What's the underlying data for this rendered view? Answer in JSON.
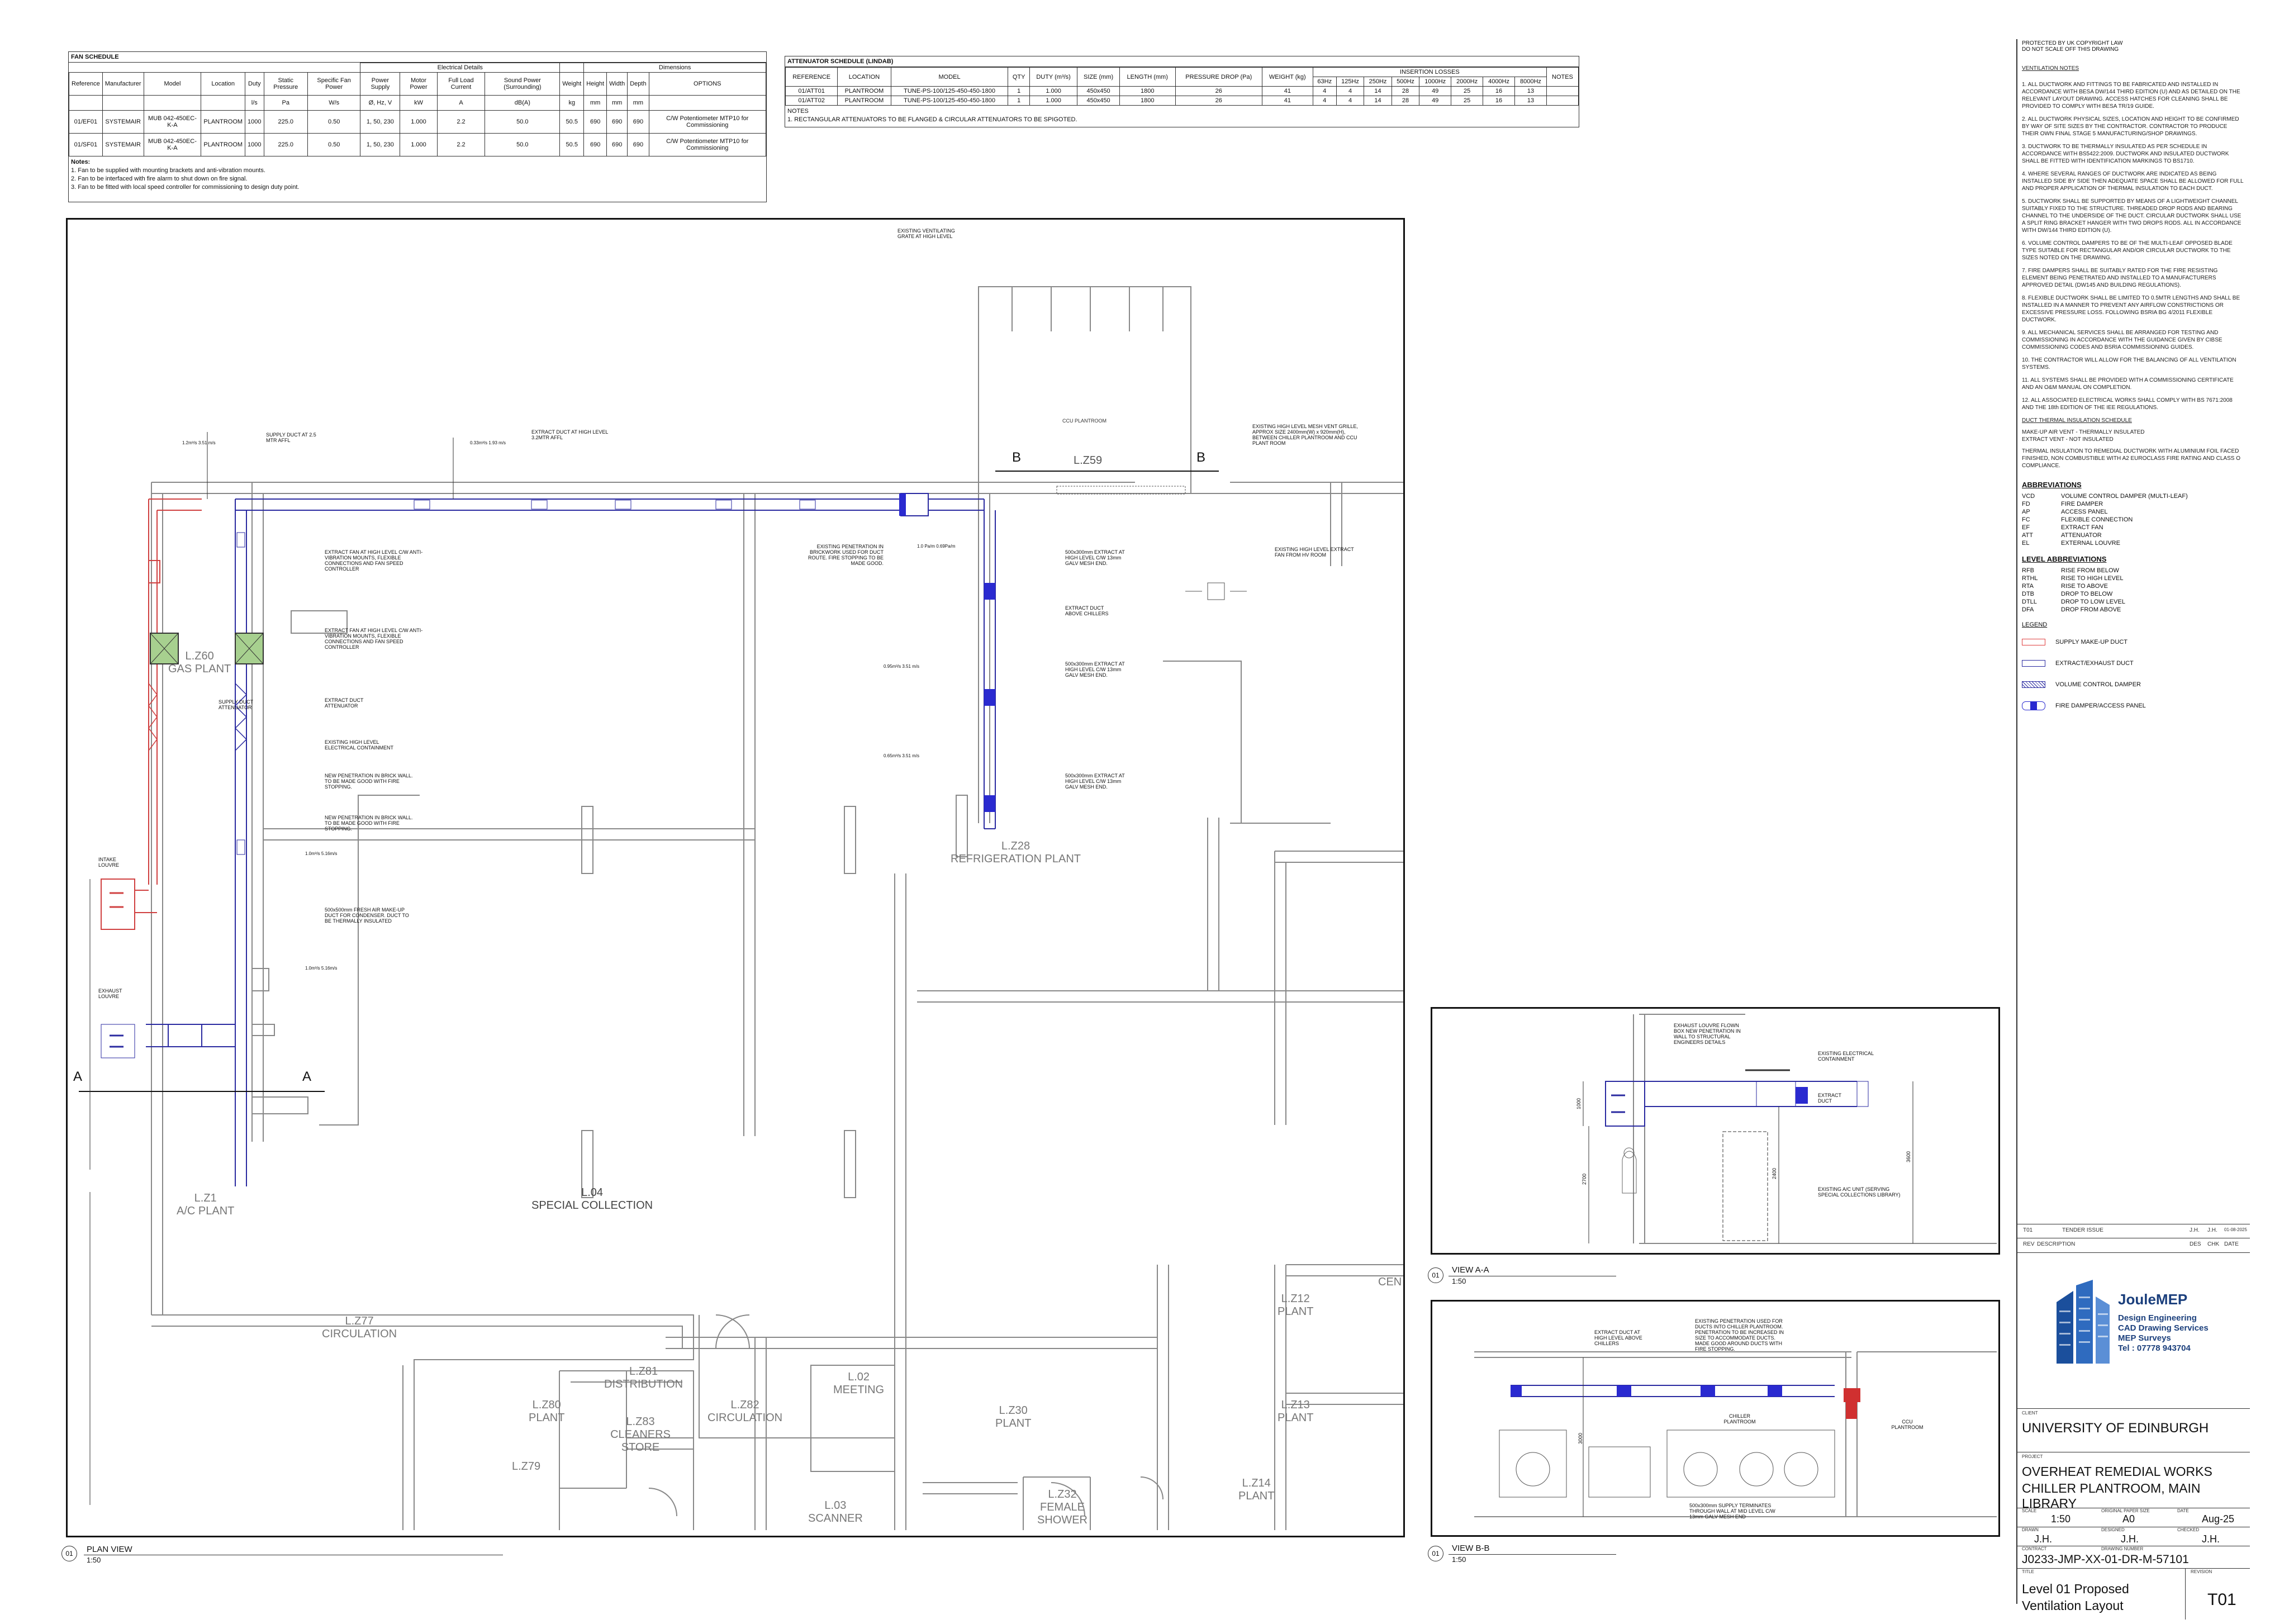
{
  "fan_schedule": {
    "title": "FAN SCHEDULE",
    "group_headers": [
      "Electrical Details",
      "Dimensions"
    ],
    "headers": [
      "Reference",
      "Manufacturer",
      "Model",
      "Location",
      "Duty",
      "Static Pressure",
      "Specific Fan Power",
      "Power Supply",
      "Motor Power",
      "Full Load Current",
      "Sound Power (Surrounding)",
      "Weight",
      "Height",
      "Width",
      "Depth",
      "OPTIONS"
    ],
    "units": [
      "",
      "",
      "",
      "",
      "l/s",
      "Pa",
      "W/s",
      "Ø, Hz, V",
      "kW",
      "A",
      "dB(A)",
      "kg",
      "mm",
      "mm",
      "mm",
      ""
    ],
    "rows": [
      [
        "01/EF01",
        "SYSTEMAIR",
        "MUB 042-450EC-K-A",
        "PLANTROOM",
        "1000",
        "225.0",
        "0.50",
        "1, 50, 230",
        "1.000",
        "2.2",
        "50.0",
        "50.5",
        "690",
        "690",
        "690",
        "C/W Potentiometer MTP10 for Commissioning"
      ],
      [
        "01/SF01",
        "SYSTEMAIR",
        "MUB 042-450EC-K-A",
        "PLANTROOM",
        "1000",
        "225.0",
        "0.50",
        "1, 50, 230",
        "1.000",
        "2.2",
        "50.0",
        "50.5",
        "690",
        "690",
        "690",
        "C/W Potentiometer MTP10 for Commissioning"
      ]
    ],
    "notes_title": "Notes:",
    "notes": [
      "1. Fan to be supplied with mounting brackets and anti-vibration mounts.",
      "2. Fan to be interfaced with fire alarm to shut down on fire signal.",
      "3. Fan to be fitted with local speed controller for commissioning to design duty point."
    ]
  },
  "attenuator_schedule": {
    "title": "ATTENUATOR SCHEDULE (LINDAB)",
    "headers": [
      "REFERENCE",
      "LOCATION",
      "MODEL",
      "QTY",
      "DUTY (m³/s)",
      "SIZE (mm)",
      "LENGTH (mm)",
      "PRESSURE DROP (Pa)",
      "WEIGHT (kg)",
      "INSERTION LOSSES",
      "NOTES"
    ],
    "bands": [
      "63Hz",
      "125Hz",
      "250Hz",
      "500Hz",
      "1000Hz",
      "2000Hz",
      "4000Hz",
      "8000Hz"
    ],
    "rows": [
      [
        "01/ATT01",
        "PLANTROOM",
        "TUNE-PS-100/125-450-450-1800",
        "1",
        "1.000",
        "450x450",
        "1800",
        "26",
        "41",
        "4",
        "4",
        "14",
        "28",
        "49",
        "25",
        "16",
        "13",
        ""
      ],
      [
        "01/ATT02",
        "PLANTROOM",
        "TUNE-PS-100/125-450-450-1800",
        "1",
        "1.000",
        "450x450",
        "1800",
        "26",
        "41",
        "4",
        "4",
        "14",
        "28",
        "49",
        "25",
        "16",
        "13",
        ""
      ]
    ],
    "notes_title": "NOTES",
    "notes": [
      "1. RECTANGULAR ATTENUATORS TO BE FLANGED & CIRCULAR ATTENUATORS TO BE SPIGOTED."
    ]
  },
  "plan": {
    "rooms": [
      {
        "name": "L.Z59"
      },
      {
        "name": "L.Z60",
        "sub": "GAS PLANT"
      },
      {
        "name": "L.Z28",
        "sub": "REFRIGERATION PLANT"
      },
      {
        "name": "L.04",
        "sub": "SPECIAL COLLECTION"
      },
      {
        "name": "L.Z1",
        "sub": "A/C PLANT"
      },
      {
        "name": "L.Z77",
        "sub": "CIRCULATION"
      },
      {
        "name": "L.Z81",
        "sub": "DISTRIBUTION"
      },
      {
        "name": "L.Z80",
        "sub": "PLANT"
      },
      {
        "name": "L.Z83",
        "sub": "CLEANERS STORE"
      },
      {
        "name": "L.Z82",
        "sub": "CIRCULATION"
      },
      {
        "name": "L.02",
        "sub": "MEETING"
      },
      {
        "name": "L.Z30",
        "sub": "PLANT"
      },
      {
        "name": "L.Z12",
        "sub": "PLANT"
      },
      {
        "name": "L.Z13",
        "sub": "PLANT"
      },
      {
        "name": "L.Z14",
        "sub": "PLANT"
      },
      {
        "name": "L.Z32",
        "sub": "FEMALE SHOWER"
      },
      {
        "name": "L.03",
        "sub": "SCANNER"
      },
      {
        "name": "L.Z79"
      },
      {
        "name": "CEN"
      }
    ],
    "ccu_label": "CCU PLANTROOM",
    "annotations": {
      "grate": "EXISTING VENTILATING GRATE AT HIGH LEVEL",
      "supply_duct": "SUPPLY DUCT AT 2.5 MTR AFFL",
      "extract_duct": "EXTRACT DUCT AT HIGH LEVEL 3.2MTR AFFL",
      "mesh_grille": "EXISTING HIGH LEVEL MESH VENT GRILLE, APPROX SIZE 2400mm(W) x 920mm(H), BETWEEN CHILLER PLANTROOM AND CCU PLANT ROOM",
      "penetration": "EXISTING PENETRATION IN BRICKWORK USED FOR DUCT ROUTE. FIRE STOPPING TO BE MADE GOOD.",
      "extract_fan_1": "EXTRACT FAN AT HIGH LEVEL C/W ANTI-VIBRATION MOUNTS, FLEXIBLE CONNECTIONS AND FAN SPEED CONTROLLER",
      "extract_fan_2": "EXTRACT FAN AT HIGH LEVEL C/W ANTI-VIBRATION MOUNTS, FLEXIBLE CONNECTIONS AND FAN SPEED CONTROLLER",
      "extract_att": "EXTRACT DUCT ATTENUATOR",
      "supply_att": "SUPPLY DUCT ATTENUATOR",
      "containment": "EXISTING HIGH LEVEL ELECTRICAL CONTAINMENT",
      "new_pen_1": "NEW PENETRATION IN BRICK WALL. TO BE MADE GOOD WITH FIRE STOPPING.",
      "new_pen_2": "NEW PENETRATION IN BRICK WALL. TO BE MADE GOOD WITH FIRE STOPPING.",
      "fresh_air": "500x500mm FRESH AIR MAKE-UP DUCT FOR CONDENSER. DUCT TO BE THERMALLY INSULATED",
      "intake": "INTAKE LOUVRE",
      "exhaust": "EXHAUST LOUVRE",
      "extract_hv": "EXISTING HIGH LEVEL EXTRACT FAN FROM HV ROOM",
      "extract_chillers": "EXTRACT DUCT ABOVE CHILLERS",
      "ext1": "500x300mm EXTRACT AT HIGH LEVEL C/W 13mm GALV MESH END.",
      "ext2": "500x300mm EXTRACT AT HIGH LEVEL C/W 13mm GALV MESH END.",
      "ext3": "500x300mm EXTRACT AT HIGH LEVEL C/W 13mm GALV MESH END."
    },
    "duct_sizes": [
      "200x150",
      "300x200",
      "450x450",
      "300x300",
      "400x400",
      "300x300",
      "500x300",
      "550x300",
      "450x450"
    ],
    "flow_labels": [
      "1.2m³/s 3.51 m/s",
      "1.0 Pa/m 0.69Pa/m",
      "0.95m³/s 3.51 m/s",
      "0.65m³/s 3.51 m/s",
      "0.33m³/s 1.93 m/s",
      "1.0m³/s 5.16m/s",
      "1.0m³/s 5.16m/s"
    ],
    "section_marks": {
      "a": "A",
      "b": "B"
    },
    "dims": [
      "1500",
      "2500",
      "1000",
      "11400",
      "400"
    ],
    "title": "PLAN VIEW",
    "scale": "1:50",
    "num": "01"
  },
  "view_aa": {
    "title": "VIEW A-A",
    "scale": "1:50",
    "num": "01",
    "annotations": {
      "louvre": "EXHAUST LOUVRE FLOWN BOX NEW PENETRATION IN WALL TO STRUCTURAL ENGINEERS DETAILS",
      "containment": "EXISTING ELECTRICAL CONTAINMENT",
      "extract_duct": "EXTRACT DUCT",
      "ac_unit": "EXISTING A/C UNIT (SERVING SPECIAL COLLECTIONS LIBRARY)"
    },
    "dims": [
      "1000",
      "3600",
      "2700",
      "2400"
    ]
  },
  "view_bb": {
    "title": "VIEW B-B",
    "scale": "1:50",
    "num": "01",
    "annotations": {
      "extract_duct": "EXTRACT DUCT AT HIGH LEVEL ABOVE CHILLERS",
      "penetration": "EXISTING PENETRATION USED FOR DUCTS INTO CHILLER PLANTROOM. PENETRATION TO BE INCREASED IN SIZE TO ACCOMMODATE DUCTS. MADE GOOD AROUND DUCTS WITH FIRE STOPPING.",
      "chiller": "CHILLER PLANTROOM",
      "ccu": "CCU PLANTROOM",
      "supply_term": "500x300mm SUPPLY TERMINATES THROUGH WALL AT MID LEVEL C/W 13mm GALV MESH END"
    },
    "dims": [
      "3000"
    ]
  },
  "title_block": {
    "copyright": "PROTECTED BY UK COPYRIGHT LAW",
    "no_scale": "DO NOT SCALE OFF THIS DRAWING",
    "notes_title": "VENTILATION NOTES",
    "notes": [
      "1. ALL DUCTWORK AND FITTINGS TO BE FABRICATED AND INSTALLED IN ACCORDANCE WITH BESA DW/144 THIRD EDITION (U) AND AS DETAILED ON THE RELEVANT LAYOUT DRAWING. ACCESS HATCHES FOR CLEANING SHALL BE PROVIDED TO COMPLY WITH BESA TR/19 GUIDE.",
      "2. ALL DUCTWORK PHYSICAL SIZES, LOCATION AND HEIGHT TO BE CONFIRMED BY WAY OF SITE SIZES BY THE CONTRACTOR. CONTRACTOR TO PRODUCE THEIR OWN FINAL STAGE 5 MANUFACTURING/SHOP DRAWINGS.",
      "3. DUCTWORK TO BE THERMALLY INSULATED AS PER SCHEDULE IN ACCORDANCE WITH BS5422:2009. DUCTWORK AND INSULATED DUCTWORK SHALL BE FITTED WITH IDENTIFICATION MARKINGS TO BS1710.",
      "4. WHERE SEVERAL RANGES OF DUCTWORK ARE INDICATED AS BEING INSTALLED SIDE BY SIDE THEN ADEQUATE SPACE SHALL BE ALLOWED FOR FULL AND PROPER APPLICATION OF THERMAL INSULATION TO EACH DUCT.",
      "5. DUCTWORK SHALL BE SUPPORTED BY MEANS OF A LIGHTWEIGHT CHANNEL SUITABLY FIXED TO THE STRUCTURE. THREADED DROP RODS AND BEARING CHANNEL TO THE UNDERSIDE OF THE DUCT. CIRCULAR DUCTWORK SHALL USE A SPLIT RING BRACKET HANGER WITH TWO DROPS RODS. ALL IN ACCORDANCE WITH DW/144 THIRD EDITION (U).",
      "6. VOLUME CONTROL DAMPERS TO BE OF THE MULTI-LEAF OPPOSED BLADE TYPE SUITABLE FOR RECTANGULAR AND/OR CIRCULAR DUCTWORK TO THE SIZES NOTED ON THE DRAWING.",
      "7. FIRE DAMPERS SHALL BE SUITABLY RATED FOR THE FIRE RESISTING ELEMENT BEING PENETRATED AND INSTALLED TO A MANUFACTURERS APPROVED DETAIL (DW145 AND BUILDING REGULATIONS).",
      "8. FLEXIBLE DUCTWORK SHALL BE LIMITED TO 0.5MTR LENGTHS AND SHALL BE INSTALLED IN A MANNER TO PREVENT ANY AIRFLOW CONSTRICTIONS OR EXCESSIVE PRESSURE LOSS. FOLLOWING BSRIA BG 4/2011 FLEXIBLE DUCTWORK.",
      "9. ALL MECHANICAL SERVICES SHALL BE ARRANGED FOR TESTING AND COMMISSIONING IN ACCORDANCE WITH THE GUIDANCE GIVEN BY CIBSE COMMISSIONING CODES AND BSRIA COMMISSIONING GUIDES.",
      "10. THE CONTRACTOR WILL ALLOW FOR THE BALANCING OF ALL VENTILATION SYSTEMS.",
      "11. ALL SYSTEMS SHALL BE PROVIDED WITH A COMMISSIONING CERTIFICATE AND AN O&M MANUAL ON COMPLETION.",
      "12. ALL ASSOCIATED ELECTRICAL WORKS SHALL COMPLY WITH BS 7671:2008 AND THE 18th EDITION OF THE IEE REGULATIONS."
    ],
    "insulation_title": "DUCT THERMAL INSULATION SCHEDULE",
    "insulation": [
      "MAKE-UP AIR VENT - THERMALLY INSULATED",
      "EXTRACT VENT - NOT INSULATED",
      "THERMAL INSULATION TO REMEDIAL DUCTWORK WITH ALUMINIUM FOIL FACED FINISHED, NON COMBUSTIBLE WITH A2 EUROCLASS FIRE RATING AND CLASS O COMPLIANCE."
    ],
    "abbr_title": "ABBREVIATIONS",
    "abbreviations": [
      [
        "VCD",
        "VOLUME CONTROL DAMPER (MULTI-LEAF)"
      ],
      [
        "FD",
        "FIRE DAMPER"
      ],
      [
        "AP",
        "ACCESS PANEL"
      ],
      [
        "FC",
        "FLEXIBLE CONNECTION"
      ],
      [
        "EF",
        "EXTRACT FAN"
      ],
      [
        "ATT",
        "ATTENUATOR"
      ],
      [
        "EL",
        "EXTERNAL LOUVRE"
      ]
    ],
    "level_title": "LEVEL ABBREVIATIONS",
    "levels": [
      [
        "RFB",
        "RISE FROM BELOW"
      ],
      [
        "RTHL",
        "RISE TO HIGH LEVEL"
      ],
      [
        "RTA",
        "RISE TO ABOVE"
      ],
      [
        "DTB",
        "DROP TO BELOW"
      ],
      [
        "DTLL",
        "DROP TO LOW LEVEL"
      ],
      [
        "DFA",
        "DROP FROM ABOVE"
      ]
    ],
    "legend_title": "LEGEND",
    "legend": [
      {
        "label": "SUPPLY MAKE-UP DUCT",
        "color": "#e04040"
      },
      {
        "label": "EXTRACT/EXHAUST DUCT",
        "color": "#2a2aa0"
      },
      {
        "label": "VOLUME CONTROL DAMPER",
        "color": "#2a2aa0"
      },
      {
        "label": "FIRE DAMPER/ACCESS PANEL",
        "color": "#2a2ad0"
      }
    ],
    "revision_row": [
      "T01",
      "TENDER ISSUE",
      "J.H.",
      "J.H.",
      "01-08-2025"
    ],
    "revision_headers": [
      "REV",
      "DESCRIPTION",
      "DES",
      "CHK",
      "DATE"
    ],
    "company": {
      "name": "JouleMEP",
      "line1": "Design Engineering",
      "line2": "CAD Drawing Services",
      "line3": "MEP Surveys",
      "tel": "Tel : 07778 943704"
    },
    "client_label": "CLIENT",
    "client": "UNIVERSITY OF EDINBURGH",
    "project_label": "PROJECT",
    "project_1": "OVERHEAT REMEDIAL WORKS",
    "project_2": "CHILLER PLANTROOM, MAIN LIBRARY",
    "scale_label": "SCALE",
    "scale": "1:50",
    "paper_label": "ORIGINAL PAPER SIZE",
    "paper": "A0",
    "date_label": "DATE",
    "date": "Aug-25",
    "drawn_label": "DRAWN",
    "drawn": "J.H.",
    "designed_label": "DESIGNED",
    "designed": "J.H.",
    "checked_label": "CHECKED",
    "checked": "J.H.",
    "contract_label": "CONTRACT",
    "drawing_no_label": "DRAWING NUMBER",
    "drawing_no": "J0233-JMP-XX-01-DR-M-57101",
    "title_label": "TITLE",
    "title_1": "Level 01 Proposed",
    "title_2": "Ventilation Layout",
    "revision_label": "REVISION",
    "revision": "T01"
  }
}
